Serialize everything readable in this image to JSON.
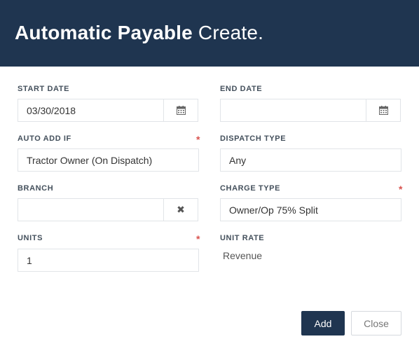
{
  "dialog": {
    "title_bold": "Automatic Payable",
    "title_light": "Create."
  },
  "fields": {
    "start_date": {
      "label": "START DATE",
      "value": "03/30/2018",
      "addon_icon": "calendar-icon"
    },
    "end_date": {
      "label": "END DATE",
      "value": "",
      "addon_icon": "calendar-icon"
    },
    "auto_add_if": {
      "label": "AUTO ADD IF",
      "value": "Tractor Owner (On Dispatch)",
      "required": "*"
    },
    "dispatch_type": {
      "label": "DISPATCH TYPE",
      "value": "Any"
    },
    "branch": {
      "label": "BRANCH",
      "value": "",
      "addon_icon": "clear-x-icon",
      "addon_glyph": "✖"
    },
    "charge_type": {
      "label": "CHARGE TYPE",
      "value": "Owner/Op 75% Split",
      "required": "*"
    },
    "units": {
      "label": "UNITS",
      "value": "1",
      "required": "*"
    },
    "unit_rate": {
      "label": "UNIT RATE",
      "value": "Revenue"
    }
  },
  "buttons": {
    "add": "Add",
    "close": "Close"
  },
  "colors": {
    "header_bg": "#1f3550",
    "required_star": "#d9534f",
    "primary_button": "#1f3550"
  }
}
